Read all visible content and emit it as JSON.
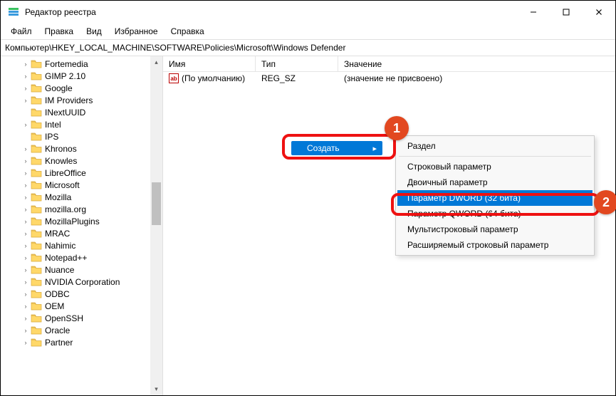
{
  "window": {
    "title": "Редактор реестра"
  },
  "menu": {
    "file": "Файл",
    "edit": "Правка",
    "view": "Вид",
    "favorites": "Избранное",
    "help": "Справка"
  },
  "address": "Компьютер\\HKEY_LOCAL_MACHINE\\SOFTWARE\\Policies\\Microsoft\\Windows Defender",
  "tree_items": [
    "Fortemedia",
    "GIMP 2.10",
    "Google",
    "IM Providers",
    "INextUUID",
    "Intel",
    "IPS",
    "Khronos",
    "Knowles",
    "LibreOffice",
    "Microsoft",
    "Mozilla",
    "mozilla.org",
    "MozillaPlugins",
    "MRAC",
    "Nahimic",
    "Notepad++",
    "Nuance",
    "NVIDIA Corporation",
    "ODBC",
    "OEM",
    "OpenSSH",
    "Oracle",
    "Partner"
  ],
  "tree_nocaret_indices": [
    4,
    6
  ],
  "list": {
    "columns": {
      "name": "Имя",
      "type": "Тип",
      "value": "Значение"
    },
    "row0": {
      "name": "(По умолчанию)",
      "type": "REG_SZ",
      "value": "(значение не присвоено)"
    }
  },
  "context": {
    "create": "Создать"
  },
  "submenu": {
    "section": "Раздел",
    "string": "Строковый параметр",
    "binary": "Двоичный параметр",
    "dword": "Параметр DWORD (32 бита)",
    "qword": "Параметр QWORD (64 бита)",
    "multi": "Мультистроковый параметр",
    "expand": "Расширяемый строковый параметр"
  },
  "badges": {
    "one": "1",
    "two": "2"
  }
}
